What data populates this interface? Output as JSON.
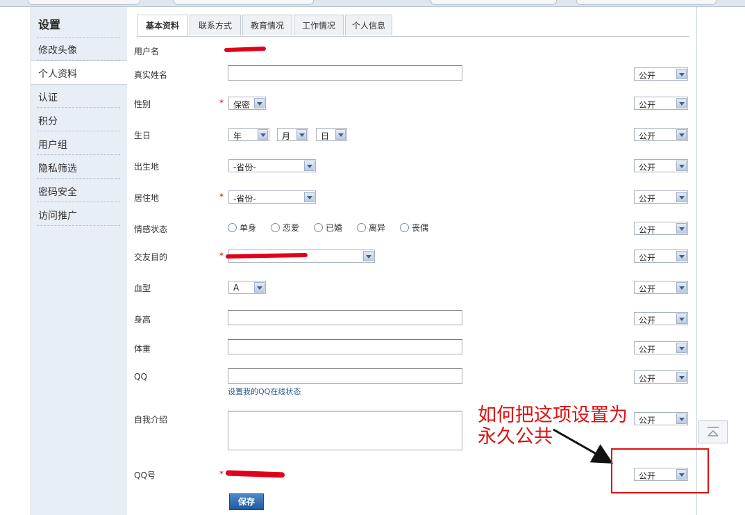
{
  "sidebar": {
    "title": "设置",
    "items": [
      {
        "label": "修改头像"
      },
      {
        "label": "个人资料"
      },
      {
        "label": "认证"
      },
      {
        "label": "积分"
      },
      {
        "label": "用户组"
      },
      {
        "label": "隐私筛选"
      },
      {
        "label": "密码安全"
      },
      {
        "label": "访问推广"
      }
    ]
  },
  "tabs": [
    "基本资料",
    "联系方式",
    "教育情况",
    "工作情况",
    "个人信息"
  ],
  "form": {
    "username_label": "用户名",
    "realname_label": "真实姓名",
    "gender_label": "性别",
    "gender_value": "保密",
    "birthday_label": "生日",
    "birth_year": "年",
    "birth_month": "月",
    "birth_day": "日",
    "birthplace_label": "出生地",
    "birthplace_value": "-省份-",
    "residence_label": "居住地",
    "residence_value": "-省份-",
    "marital_label": "情感状态",
    "marital_options": [
      "单身",
      "恋爱",
      "已婚",
      "离异",
      "丧偶"
    ],
    "purpose_label": "交友目的",
    "bloodtype_label": "血型",
    "bloodtype_value": "A",
    "height_label": "身高",
    "weight_label": "体重",
    "qq_label": "QQ",
    "qq_link": "设置我的QQ在线状态",
    "bio_label": "自我介绍",
    "qqnum_label": "QQ号",
    "privacy_value": "公开",
    "save_label": "保存"
  },
  "annotation": {
    "line1": "如何把这项设置为",
    "line2": "永久公共"
  },
  "colors": {
    "annotation": "#e01010",
    "sidebar_bg": "#e8eef5",
    "save_button": "#2a67ad"
  }
}
